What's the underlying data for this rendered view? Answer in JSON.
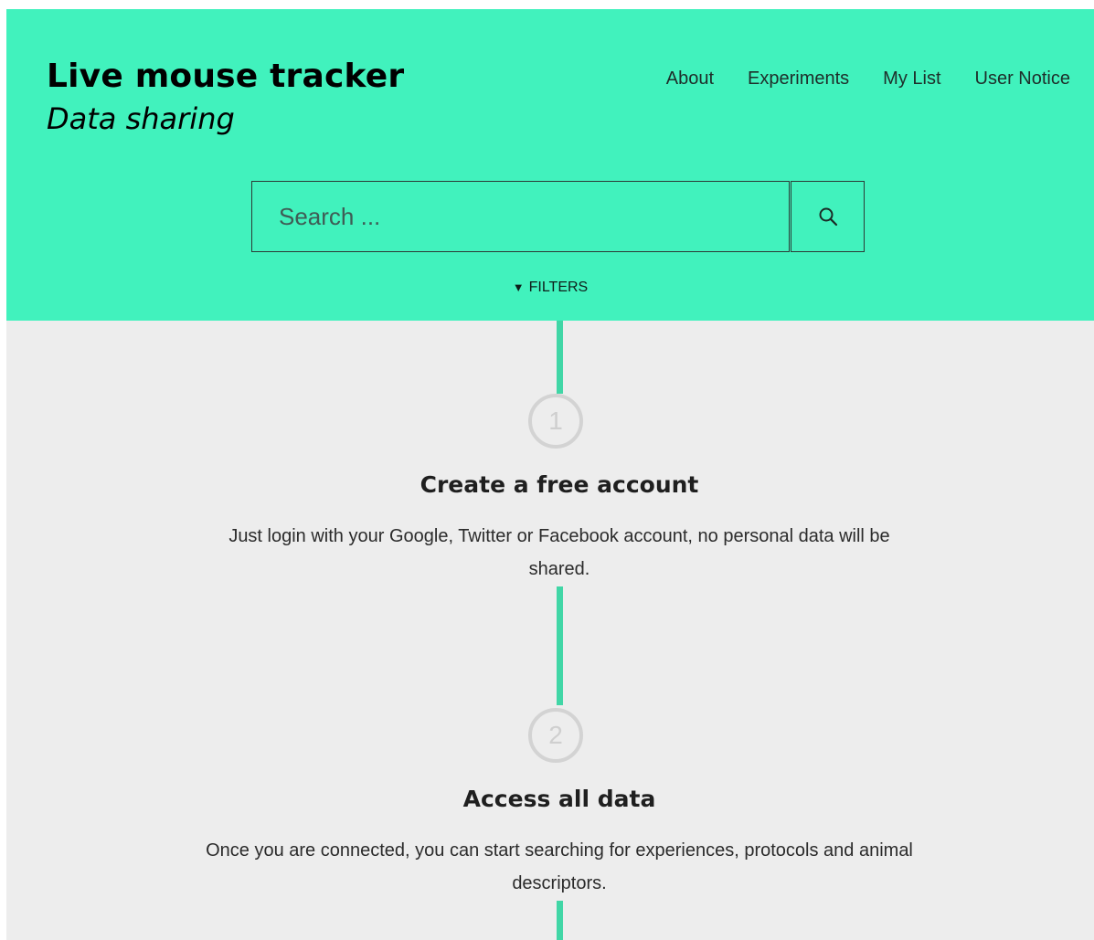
{
  "header": {
    "title": "Live mouse tracker",
    "subtitle": "Data sharing",
    "nav": [
      "About",
      "Experiments",
      "My List",
      "User Notice"
    ]
  },
  "search": {
    "placeholder": "Search ...",
    "filters_label": "FILTERS"
  },
  "steps": [
    {
      "number": "1",
      "title": "Create a free account",
      "description": "Just login with your Google, Twitter or Facebook account, no personal data will be shared."
    },
    {
      "number": "2",
      "title": "Access all data",
      "description": "Once you are connected, you can start searching for experiences, protocols and animal descriptors."
    }
  ],
  "colors": {
    "accent": "#41f2bd",
    "line": "#41d6a6",
    "background": "#ededed",
    "circle": "#d3d3d3"
  },
  "icons": {
    "search": "magnifier",
    "filters": "triangle-down"
  }
}
